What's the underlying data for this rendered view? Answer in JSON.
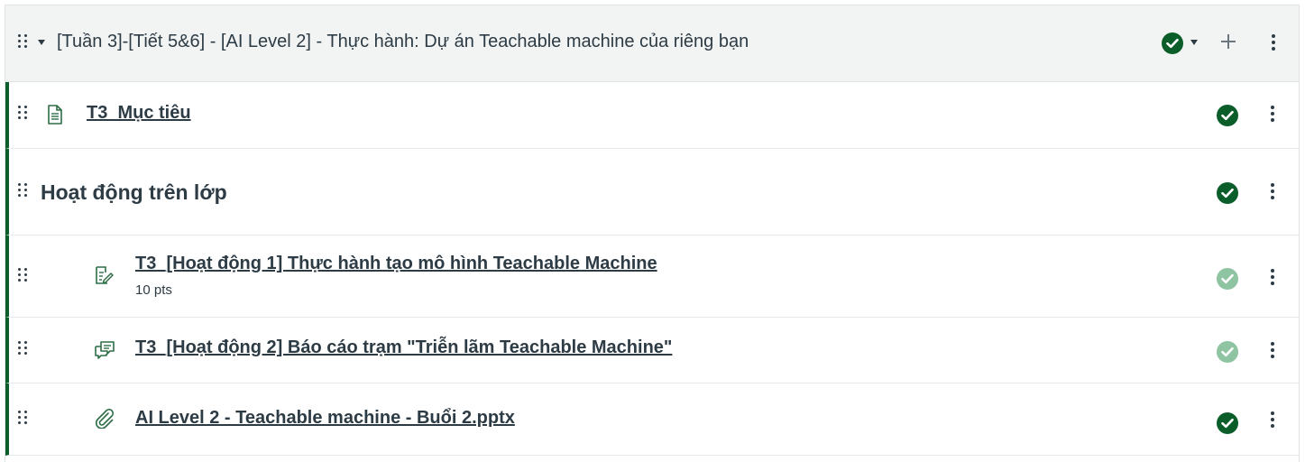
{
  "module": {
    "title": "[Tuần 3]-[Tiết 5&6] - [AI Level 2] - Thực hành: Dự án Teachable machine của riêng bạn",
    "published": true
  },
  "items": [
    {
      "type": "page",
      "icon": "document-icon",
      "title": "T3_Mục tiêu",
      "published": true
    },
    {
      "type": "subheader",
      "title": "Hoạt động trên lớp",
      "published": true
    },
    {
      "type": "assignment",
      "icon": "assignment-icon",
      "title": "T3_[Hoạt động 1] Thực hành tạo mô hình Teachable Machine",
      "meta": "10 pts",
      "published": true,
      "status_style": "light"
    },
    {
      "type": "discussion",
      "icon": "discussion-icon",
      "title": "T3_[Hoạt động 2] Báo cáo trạm \"Triễn lãm Teachable Machine\"",
      "published": true,
      "status_style": "light"
    },
    {
      "type": "file",
      "icon": "paperclip-icon",
      "title": "AI Level 2 - Teachable machine - Buổi 2.pptx",
      "published": true
    }
  ],
  "colors": {
    "published_dark": "#0b5d2a",
    "published_light": "#8fc4a2",
    "accent_border": "#0b5d2a"
  }
}
